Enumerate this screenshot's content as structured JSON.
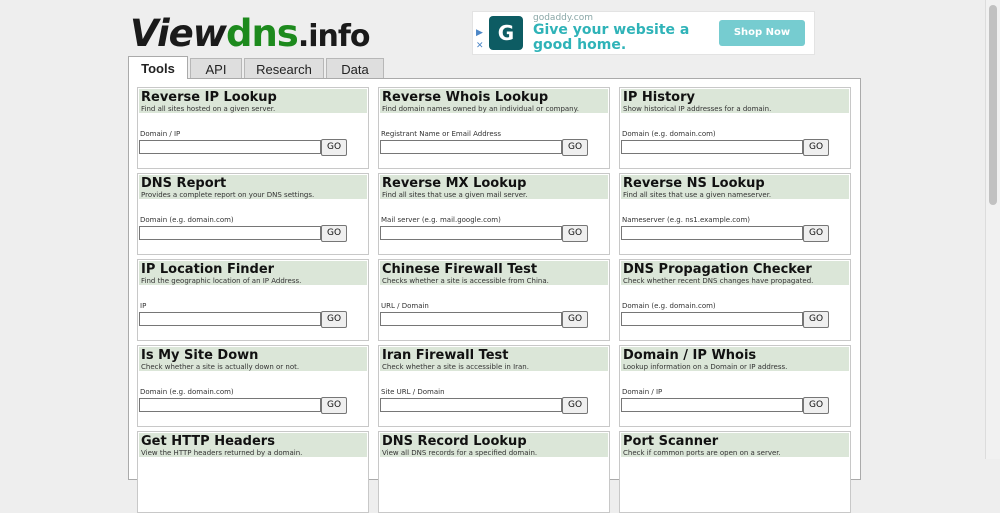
{
  "logo": {
    "part1": "View",
    "part2": "dns",
    "part3": ".info"
  },
  "ad": {
    "domain": "godaddy.com",
    "headline": "Give your website a good home.",
    "button": "Shop Now",
    "logo_glyph": "G",
    "info_glyph": "▶",
    "close_glyph": "✕"
  },
  "tabs": [
    "Tools",
    "API",
    "Research",
    "Data"
  ],
  "go_label": "GO",
  "tools": [
    {
      "title": "Reverse IP Lookup",
      "desc": "Find all sites hosted on a given server.",
      "label": "Domain / IP",
      "example": ""
    },
    {
      "title": "Reverse Whois Lookup",
      "desc": "Find domain names owned by an individual or company.",
      "label": "Registrant Name or Email Address",
      "example": ""
    },
    {
      "title": "IP History",
      "desc": "Show historical IP addresses for a domain.",
      "label": "Domain (e.g. domain.com)",
      "example": ""
    },
    {
      "title": "DNS Report",
      "desc": "Provides a complete report on your DNS settings.",
      "label": "Domain (e.g. domain.com)",
      "example": ""
    },
    {
      "title": "Reverse MX Lookup",
      "desc": "Find all sites that use a given mail server.",
      "label": "Mail server (e.g. mail.google.com)",
      "example": ""
    },
    {
      "title": "Reverse NS Lookup",
      "desc": "Find all sites that use a given nameserver.",
      "label": "Nameserver (e.g. ns1.example.com)",
      "example": ""
    },
    {
      "title": "IP Location Finder",
      "desc": "Find the geographic location of an IP Address.",
      "label": "IP",
      "example": ""
    },
    {
      "title": "Chinese Firewall Test",
      "desc": "Checks whether a site is accessible from China.",
      "label": "URL / Domain",
      "example": ""
    },
    {
      "title": "DNS Propagation Checker",
      "desc": "Check whether recent DNS changes have propagated.",
      "label": "Domain (e.g. domain.com)",
      "example": ""
    },
    {
      "title": "Is My Site Down",
      "desc": "Check whether a site is actually down or not.",
      "label": "Domain (e.g. domain.com)",
      "example": ""
    },
    {
      "title": "Iran Firewall Test",
      "desc": "Check whether a site is accessible in Iran.",
      "label": "Site URL / Domain",
      "example": ""
    },
    {
      "title": "Domain / IP Whois",
      "desc": "Lookup information on a Domain or IP address.",
      "label": "Domain / IP",
      "example": ""
    },
    {
      "title": "Get HTTP Headers",
      "desc": "View the HTTP headers returned by a domain.",
      "label": "",
      "example": ""
    },
    {
      "title": "DNS Record Lookup",
      "desc": "View all DNS records for a specified domain.",
      "label": "",
      "example": ""
    },
    {
      "title": "Port Scanner",
      "desc": "Check if common ports are open on a server.",
      "label": "",
      "example": ""
    }
  ]
}
